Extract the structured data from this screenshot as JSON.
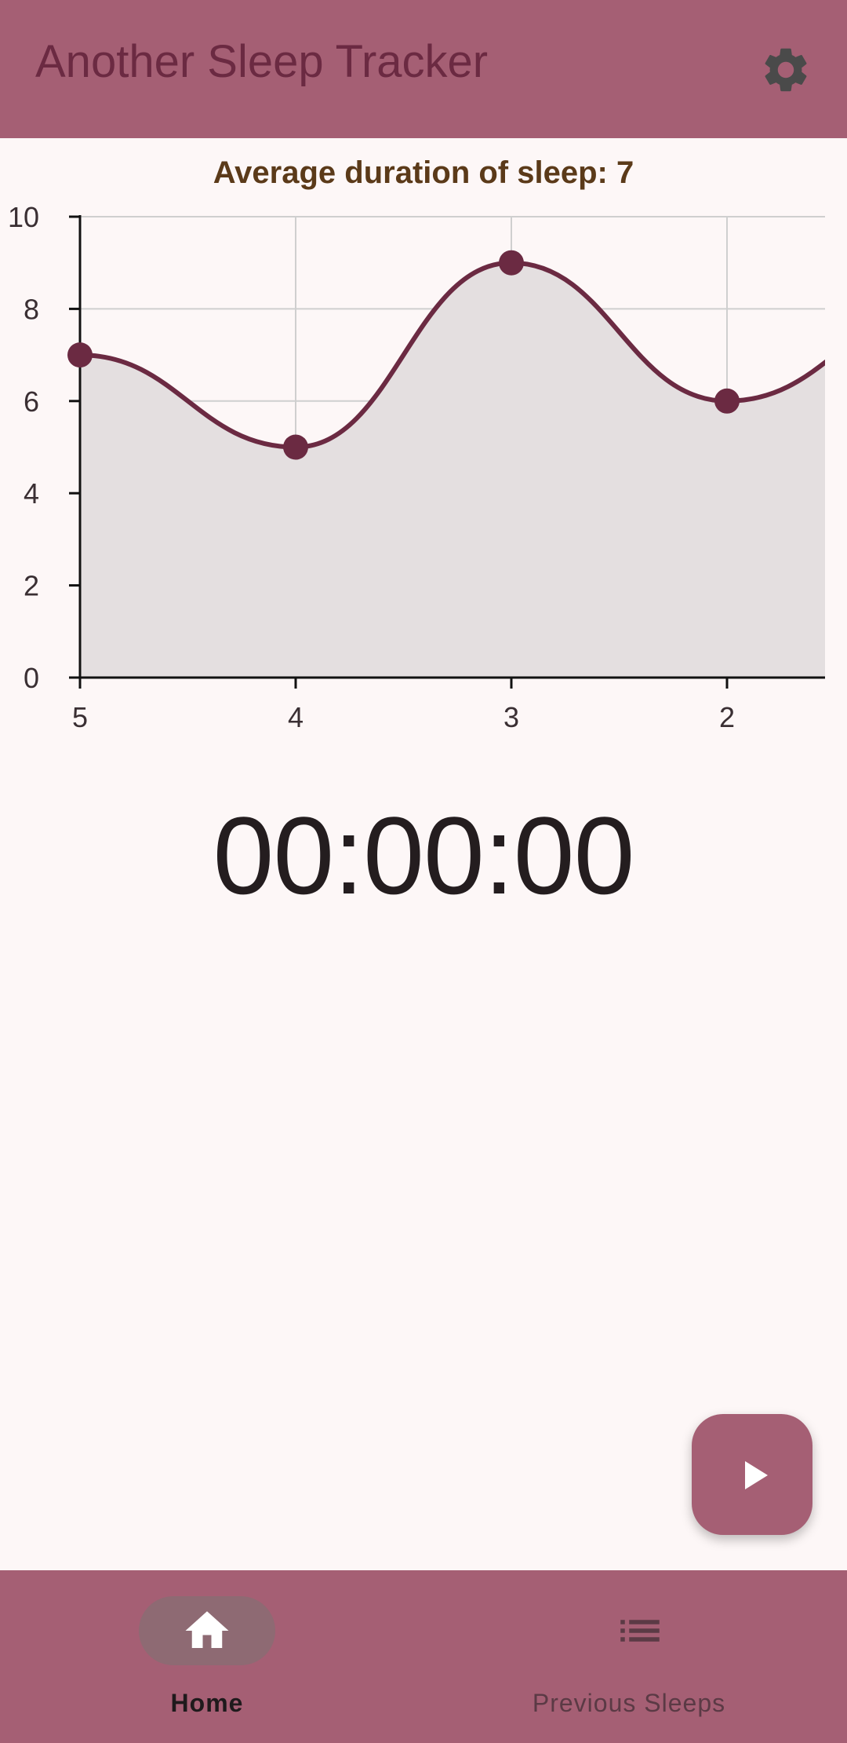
{
  "app": {
    "title": "Another Sleep Tracker"
  },
  "icons": {
    "settings": "gear-icon",
    "play": "play-icon",
    "home": "home-icon",
    "list": "list-icon"
  },
  "colors": {
    "app_bar": "#a55f74",
    "title_text": "#6b2a42",
    "chart_line": "#6b2a42",
    "chart_fill": "#e4dfe0",
    "chart_title": "#5b3a19",
    "background": "#fdf7f7"
  },
  "chart_data": {
    "type": "area",
    "title": "Average duration of sleep: 7",
    "x": [
      "5",
      "4",
      "3",
      "2"
    ],
    "series": [
      {
        "values": [
          7,
          5,
          9,
          6
        ]
      }
    ],
    "ylim": [
      0,
      10
    ],
    "yticks": [
      "0",
      "2",
      "4",
      "6",
      "8",
      "10"
    ],
    "xlabel": "",
    "ylabel": "",
    "grid": true,
    "legend": "none"
  },
  "timer": {
    "value": "00:00:00"
  },
  "bottom_nav": {
    "items": [
      {
        "label": "Home",
        "icon": "home-icon",
        "selected": true
      },
      {
        "label": "Previous Sleeps",
        "icon": "list-icon",
        "selected": false
      }
    ]
  }
}
